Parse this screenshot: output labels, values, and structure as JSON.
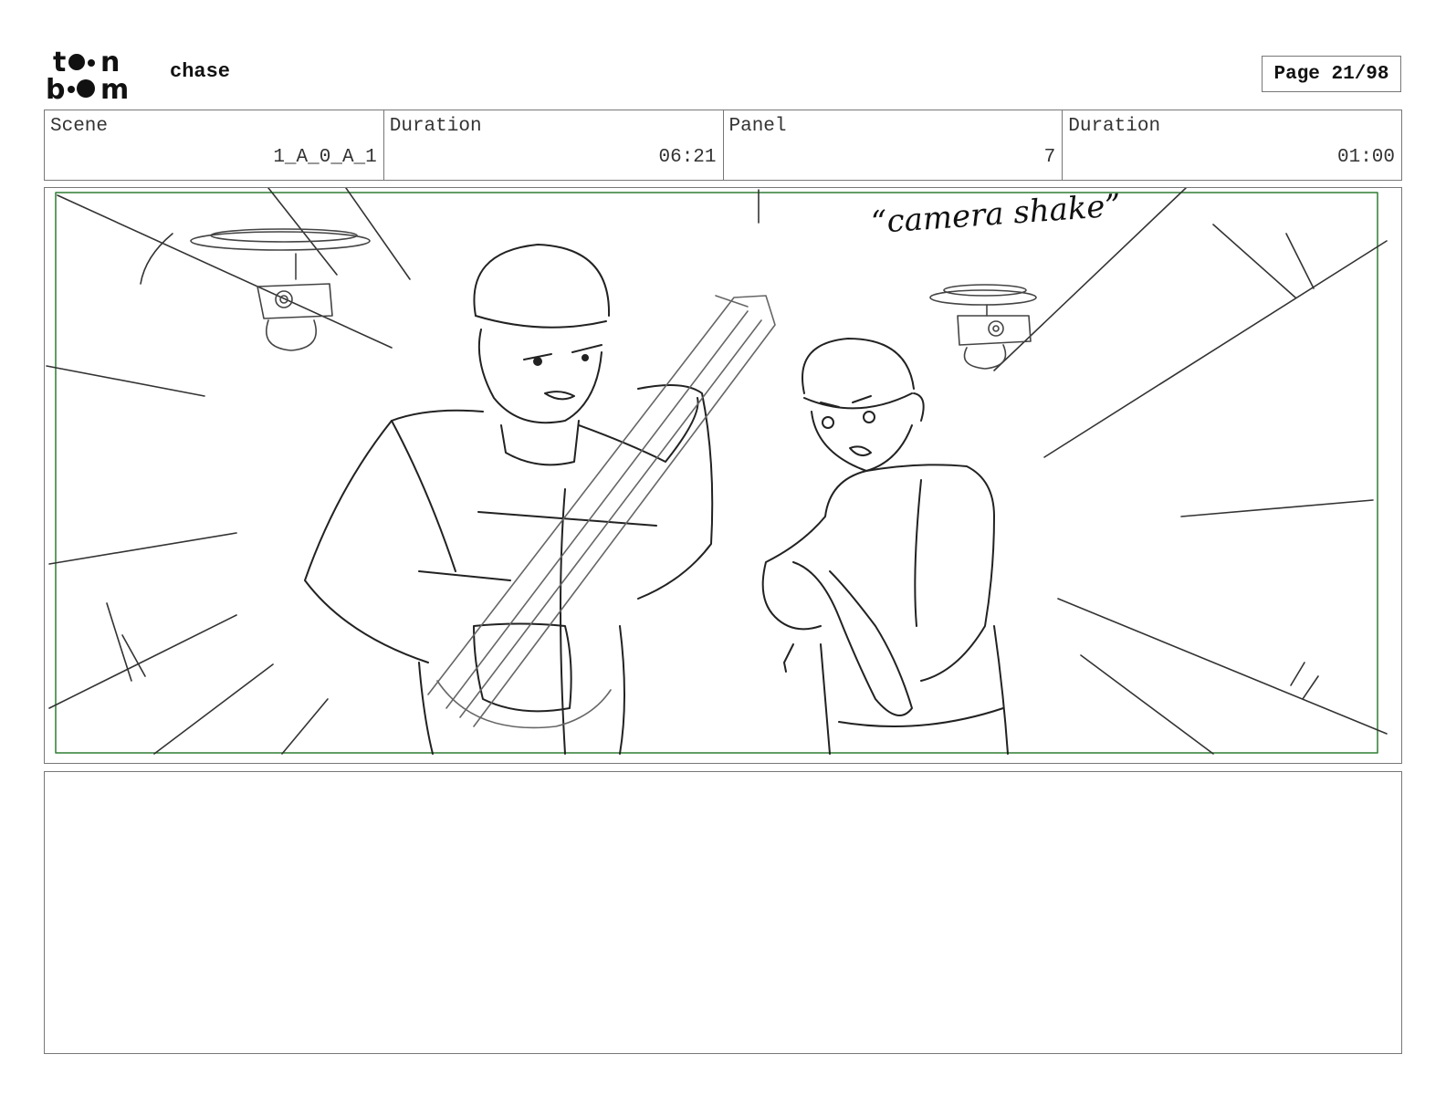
{
  "header": {
    "logo_text": "toon boom",
    "project_title": "chase",
    "page_indicator": "Page 21/98"
  },
  "info": [
    {
      "label": "Scene",
      "value": "1_A_0_A_1"
    },
    {
      "label": "Duration",
      "value": "06:21"
    },
    {
      "label": "Panel",
      "value": "7"
    },
    {
      "label": "Duration",
      "value": "01:00"
    }
  ],
  "panel": {
    "annotation": "“camera shake”",
    "safe_frame_color": "#2e7d32"
  },
  "notes": {
    "text": ""
  }
}
